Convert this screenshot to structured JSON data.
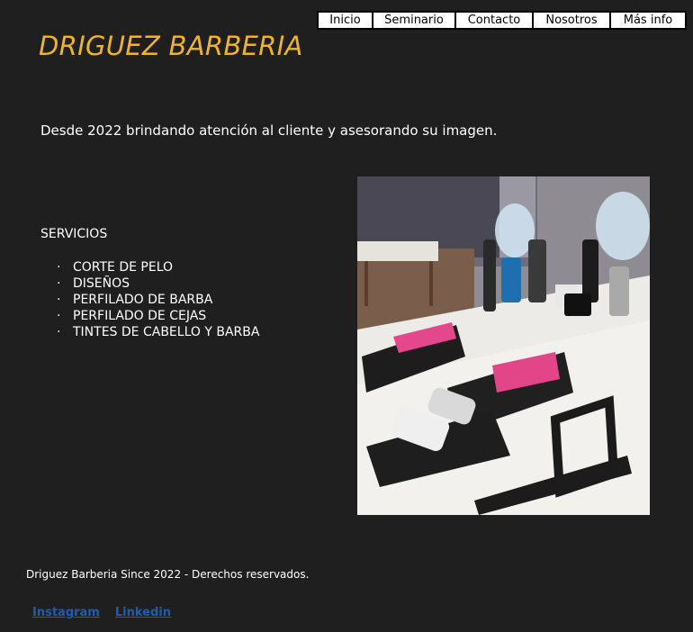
{
  "nav": {
    "items": [
      {
        "label": "Inicio"
      },
      {
        "label": "Seminario"
      },
      {
        "label": "Contacto"
      },
      {
        "label": "Nosotros"
      },
      {
        "label": "Más info"
      }
    ]
  },
  "header": {
    "brand": "DRIGUEZ BARBERIA"
  },
  "main": {
    "tagline": "Desde 2022 brindando atención al cliente y asesorando su imagen.",
    "services_title": "SERVICIOS",
    "services": [
      {
        "label": "CORTE DE PELO"
      },
      {
        "label": "DISEÑOS"
      },
      {
        "label": "PERFILADO DE BARBA"
      },
      {
        "label": "PERFILADO DE CEJAS"
      },
      {
        "label": "TINTES DE CABELLO Y BARBA"
      }
    ],
    "bullet": "·"
  },
  "footer": {
    "text": "Driguez Barberia Since 2022 - Derechos reservados.",
    "links": [
      {
        "label": "Instagram"
      },
      {
        "label": "Linkedin"
      }
    ]
  },
  "colors": {
    "accent": "#f0b429",
    "background": "#1f1f1f",
    "link": "#1e5eb0"
  }
}
